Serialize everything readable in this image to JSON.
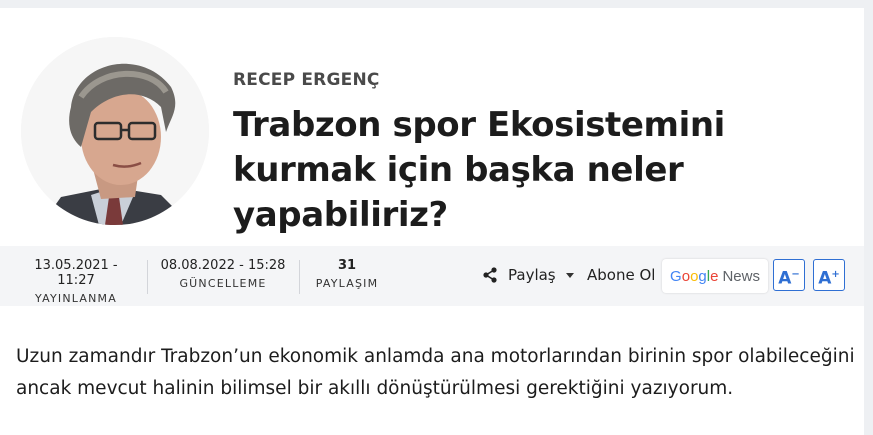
{
  "article": {
    "author": "RECEP ERGENÇ",
    "title": "Trabzon spor Ekosistemini kurmak için başka neler yapabiliriz?",
    "avatar_icon": "author-portrait"
  },
  "meta": {
    "published_value": "13.05.2021 - 11:27",
    "published_label": "YAYINLANMA",
    "updated_value": "08.08.2022 - 15:28",
    "updated_label": "GÜNCELLEME",
    "shares_value": "31",
    "shares_label": "PAYLAŞIM"
  },
  "actions": {
    "share_label": "Paylaş",
    "share_icon": "share-icon",
    "subscribe_label": "Abone Ol",
    "google_news": {
      "g": "Google",
      "news": "News"
    },
    "font_decrease": "A",
    "font_increase": "A",
    "accent_color": "#2f6fd3"
  },
  "body": {
    "paragraph": "Uzun zamandır Trabzon’un ekonomik anlamda ana motorlarından birinin spor olabileceğini ancak mevcut halinin bilimsel bir akıllı dönüştürülmesi gerektiğini yazıyorum."
  }
}
